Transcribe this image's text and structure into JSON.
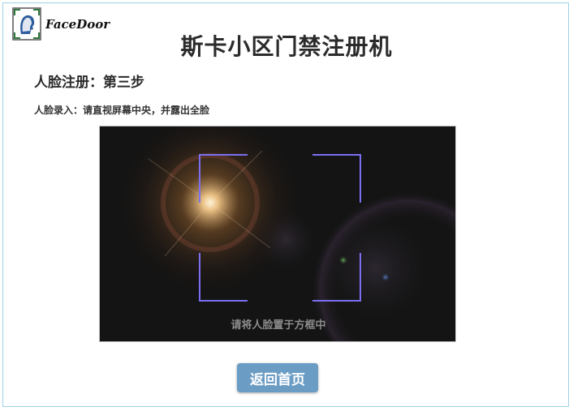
{
  "brand": {
    "name": "FaceDoor",
    "logo_icon": "face-scan-icon"
  },
  "title": "斯卡小区门禁注册机",
  "step_heading": "人脸注册：第三步",
  "instruction": "人脸录入：请直视屏幕中央，并露出全脸",
  "camera": {
    "hint": "请将人脸置于方框中",
    "frame_color": "#7b6ff2"
  },
  "actions": {
    "home_label": "返回首页"
  },
  "colors": {
    "border": "#9fd3e6",
    "button": "#6b9cc4"
  }
}
